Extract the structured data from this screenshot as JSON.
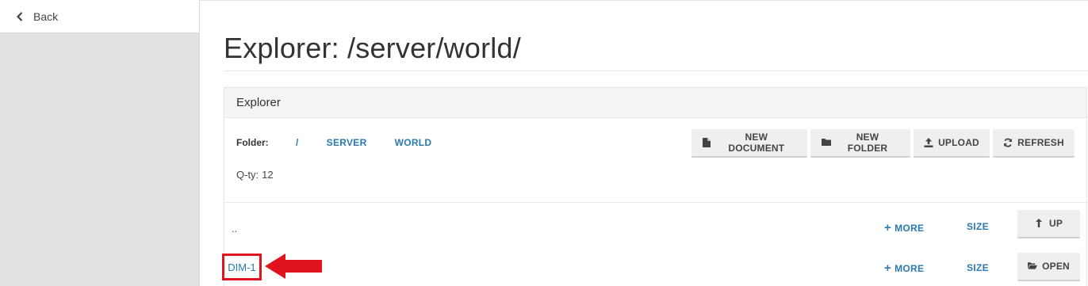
{
  "sidebar": {
    "back_label": "Back"
  },
  "page": {
    "title": "Explorer: /server/world/"
  },
  "panel": {
    "heading": "Explorer",
    "folder_label": "Folder:",
    "breadcrumbs": [
      "/",
      "SERVER",
      "WORLD"
    ],
    "qty_label": "Q-ty:",
    "qty_value": "12"
  },
  "toolbar": {
    "new_document": "NEW DOCUMENT",
    "new_folder": "NEW FOLDER",
    "upload": "UPLOAD",
    "refresh": "REFRESH"
  },
  "rows": [
    {
      "name": "..",
      "more": "MORE",
      "size": "SIZE",
      "action": "UP"
    },
    {
      "name": "DIM-1",
      "more": "MORE",
      "size": "SIZE",
      "action": "OPEN"
    }
  ],
  "colors": {
    "link": "#2a7ab0",
    "highlight": "#e0141e",
    "sidebar_bg": "#e1e1e1"
  },
  "icons": [
    "chevron-left-icon",
    "file-icon",
    "folder-icon",
    "upload-icon",
    "refresh-icon",
    "plus-icon",
    "level-up-icon",
    "folder-open-icon",
    "arrow-left-icon"
  ]
}
